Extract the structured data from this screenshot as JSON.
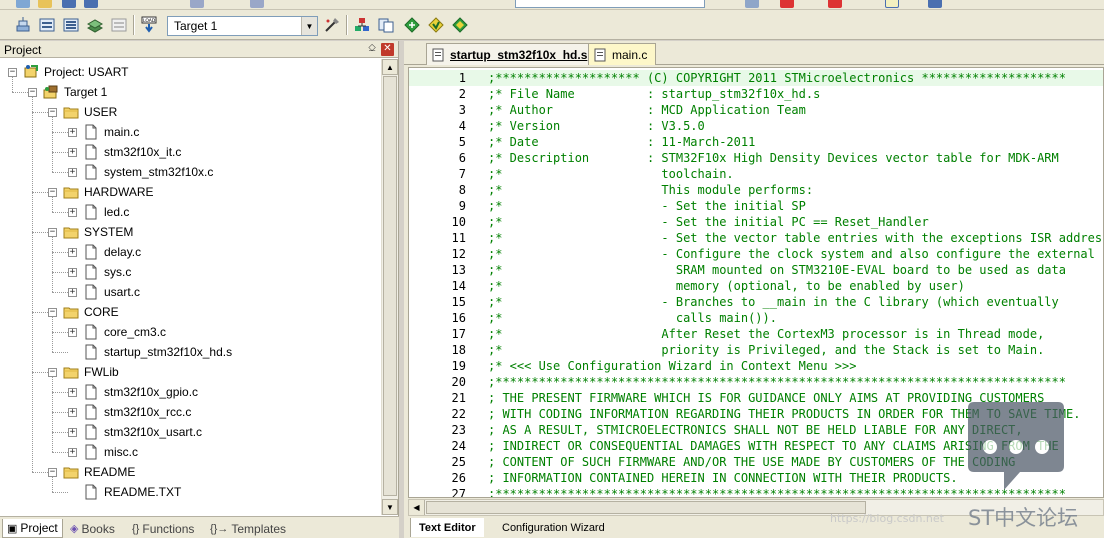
{
  "toolbar": {
    "target_select": "Target 1",
    "buttons": [
      "translate-icon",
      "build-icon",
      "rebuild-icon",
      "batch-build-icon",
      "stop-build-icon",
      "download-icon",
      "target-options-icon",
      "manage-project-icon",
      "file-extensions-icon",
      "select-packs-icon",
      "pack-installer-icon",
      "run-time-env-icon"
    ]
  },
  "project_panel": {
    "title": "Project",
    "pin": "⎐",
    "close": "✕",
    "tree": [
      {
        "label": "Project: USART",
        "kind": "project",
        "depth": 0,
        "exp": "−"
      },
      {
        "label": "Target 1",
        "kind": "target",
        "depth": 1,
        "exp": "−"
      },
      {
        "label": "USER",
        "kind": "folder",
        "depth": 2,
        "exp": "−"
      },
      {
        "label": "main.c",
        "kind": "file",
        "depth": 3,
        "exp": "+"
      },
      {
        "label": "stm32f10x_it.c",
        "kind": "file",
        "depth": 3,
        "exp": "+"
      },
      {
        "label": "system_stm32f10x.c",
        "kind": "file",
        "depth": 3,
        "exp": "+"
      },
      {
        "label": "HARDWARE",
        "kind": "folder",
        "depth": 2,
        "exp": "−"
      },
      {
        "label": "led.c",
        "kind": "file",
        "depth": 3,
        "exp": "+"
      },
      {
        "label": "SYSTEM",
        "kind": "folder",
        "depth": 2,
        "exp": "−"
      },
      {
        "label": "delay.c",
        "kind": "file",
        "depth": 3,
        "exp": "+"
      },
      {
        "label": "sys.c",
        "kind": "file",
        "depth": 3,
        "exp": "+"
      },
      {
        "label": "usart.c",
        "kind": "file",
        "depth": 3,
        "exp": "+"
      },
      {
        "label": "CORE",
        "kind": "folder",
        "depth": 2,
        "exp": "−"
      },
      {
        "label": "core_cm3.c",
        "kind": "file",
        "depth": 3,
        "exp": "+"
      },
      {
        "label": "startup_stm32f10x_hd.s",
        "kind": "file",
        "depth": 3,
        "exp": ""
      },
      {
        "label": "FWLib",
        "kind": "folder",
        "depth": 2,
        "exp": "−"
      },
      {
        "label": "stm32f10x_gpio.c",
        "kind": "file",
        "depth": 3,
        "exp": "+"
      },
      {
        "label": "stm32f10x_rcc.c",
        "kind": "file",
        "depth": 3,
        "exp": "+"
      },
      {
        "label": "stm32f10x_usart.c",
        "kind": "file",
        "depth": 3,
        "exp": "+"
      },
      {
        "label": "misc.c",
        "kind": "file",
        "depth": 3,
        "exp": "+"
      },
      {
        "label": "README",
        "kind": "folder",
        "depth": 2,
        "exp": "−"
      },
      {
        "label": "README.TXT",
        "kind": "file",
        "depth": 3,
        "exp": ""
      }
    ],
    "tabs": [
      {
        "label": "Project",
        "icon": "▣",
        "active": true
      },
      {
        "label": "Books",
        "icon": "◈",
        "active": false
      },
      {
        "label": "Functions",
        "icon": "{}",
        "active": false
      },
      {
        "label": "Templates",
        "icon": "{}→",
        "active": false
      }
    ]
  },
  "editor": {
    "tabs": [
      {
        "label": "startup_stm32f10x_hd.s",
        "active": true
      },
      {
        "label": "main.c",
        "active": false
      }
    ],
    "lines": [
      {
        "n": "1",
        "t": ";******************** (C) COPYRIGHT 2011 STMicroelectronics ********************"
      },
      {
        "n": "2",
        "t": ";* File Name          : startup_stm32f10x_hd.s"
      },
      {
        "n": "3",
        "t": ";* Author             : MCD Application Team"
      },
      {
        "n": "4",
        "t": ";* Version            : V3.5.0"
      },
      {
        "n": "5",
        "t": ";* Date               : 11-March-2011"
      },
      {
        "n": "6",
        "t": ";* Description        : STM32F10x High Density Devices vector table for MDK-ARM"
      },
      {
        "n": "7",
        "t": ";*                      toolchain."
      },
      {
        "n": "8",
        "t": ";*                      This module performs:"
      },
      {
        "n": "9",
        "t": ";*                      - Set the initial SP"
      },
      {
        "n": "10",
        "t": ";*                      - Set the initial PC == Reset_Handler"
      },
      {
        "n": "11",
        "t": ";*                      - Set the vector table entries with the exceptions ISR address"
      },
      {
        "n": "12",
        "t": ";*                      - Configure the clock system and also configure the external"
      },
      {
        "n": "13",
        "t": ";*                        SRAM mounted on STM3210E-EVAL board to be used as data"
      },
      {
        "n": "14",
        "t": ";*                        memory (optional, to be enabled by user)"
      },
      {
        "n": "15",
        "t": ";*                      - Branches to __main in the C library (which eventually"
      },
      {
        "n": "16",
        "t": ";*                        calls main())."
      },
      {
        "n": "17",
        "t": ";*                      After Reset the CortexM3 processor is in Thread mode,"
      },
      {
        "n": "18",
        "t": ";*                      priority is Privileged, and the Stack is set to Main."
      },
      {
        "n": "19",
        "t": ";* <<< Use Configuration Wizard in Context Menu >>>"
      },
      {
        "n": "20",
        "t": ";*******************************************************************************"
      },
      {
        "n": "21",
        "t": "; THE PRESENT FIRMWARE WHICH IS FOR GUIDANCE ONLY AIMS AT PROVIDING CUSTOMERS"
      },
      {
        "n": "22",
        "t": "; WITH CODING INFORMATION REGARDING THEIR PRODUCTS IN ORDER FOR THEM TO SAVE TIME."
      },
      {
        "n": "23",
        "t": "; AS A RESULT, STMICROELECTRONICS SHALL NOT BE HELD LIABLE FOR ANY DIRECT,"
      },
      {
        "n": "24",
        "t": "; INDIRECT OR CONSEQUENTIAL DAMAGES WITH RESPECT TO ANY CLAIMS ARISING FROM THE"
      },
      {
        "n": "25",
        "t": "; CONTENT OF SUCH FIRMWARE AND/OR THE USE MADE BY CUSTOMERS OF THE CODING"
      },
      {
        "n": "26",
        "t": "; INFORMATION CONTAINED HEREIN IN CONNECTION WITH THEIR PRODUCTS."
      },
      {
        "n": "27",
        "t": ";*******************************************************************************"
      }
    ],
    "bottom_tabs": [
      {
        "label": "Text Editor",
        "active": true
      },
      {
        "label": "Configuration Wizard",
        "active": false
      }
    ]
  },
  "watermark": {
    "brand": "ST中文论坛",
    "url": "https://blog.csdn.net"
  },
  "colors": {
    "comment": "#008000",
    "chrome": "#ece9d8",
    "active_tab_file": "#fdf7c9"
  }
}
